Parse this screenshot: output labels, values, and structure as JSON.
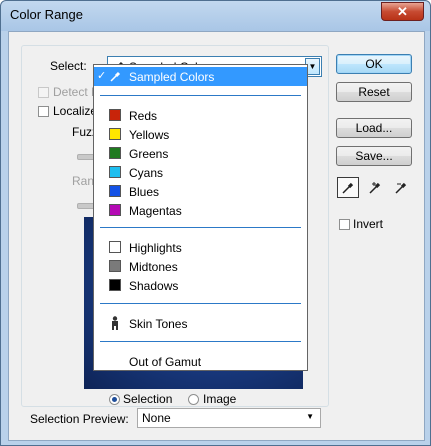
{
  "window": {
    "title": "Color Range",
    "close_symbol": "✕"
  },
  "select": {
    "label": "Select:",
    "value": "Sampled Colors"
  },
  "options": {
    "detect_faces_label": "Detect F",
    "localized_label": "Localized",
    "fuzziness_label": "Fuzzin",
    "range_label": "Range"
  },
  "view": {
    "selection_label": "Selection",
    "image_label": "Image",
    "selected": "Selection"
  },
  "buttons": {
    "ok": "OK",
    "reset": "Reset",
    "load": "Load...",
    "save": "Save..."
  },
  "invert": {
    "label": "Invert"
  },
  "selection_preview": {
    "label": "Selection Preview:",
    "value": "None"
  },
  "dropdown": {
    "sampled": "Sampled Colors",
    "reds": "Reds",
    "yellows": "Yellows",
    "greens": "Greens",
    "cyans": "Cyans",
    "blues": "Blues",
    "magentas": "Magentas",
    "highlights": "Highlights",
    "midtones": "Midtones",
    "shadows": "Shadows",
    "skin_tones": "Skin Tones",
    "out_of_gamut": "Out of Gamut",
    "check_mark": "✓"
  },
  "colors": {
    "reds": "#c8240a",
    "yellows": "#ffe600",
    "greens": "#1f7a1f",
    "cyans": "#1ebeef",
    "blues": "#1452e6",
    "magentas": "#b40ab4",
    "highlights": "#ffffff",
    "midtones": "#7a7a7a",
    "shadows": "#000000",
    "highlight_bg": "#3399ff"
  }
}
